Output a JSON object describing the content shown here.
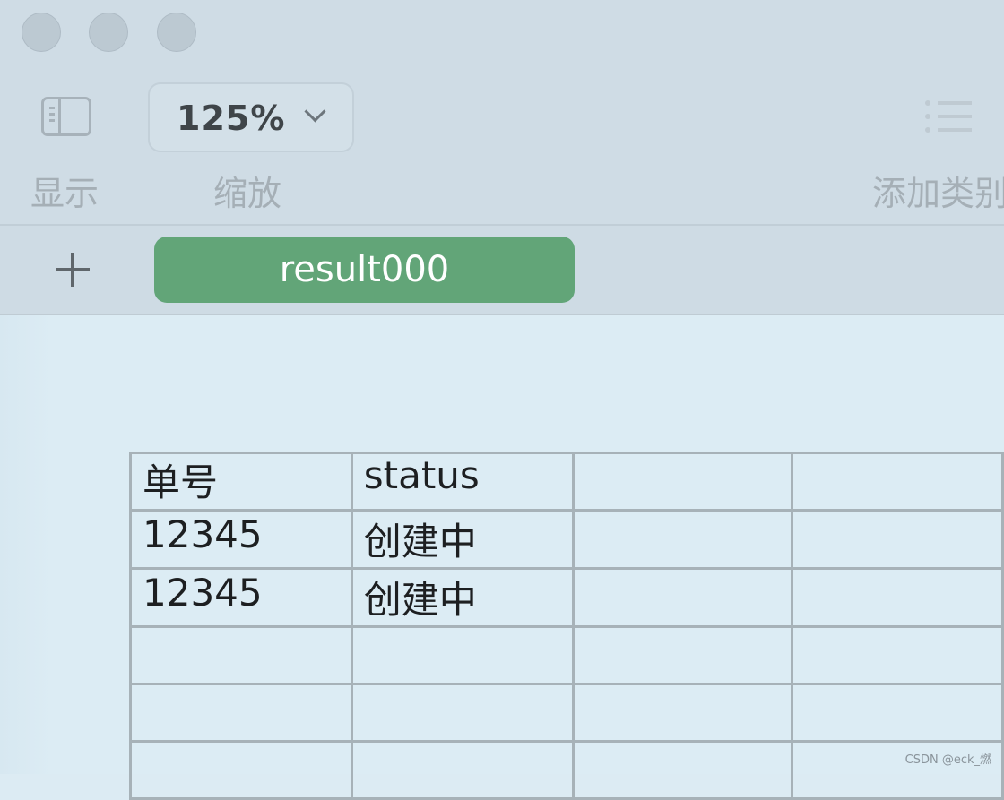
{
  "window": {
    "controls": [
      "close",
      "minimize",
      "zoom"
    ]
  },
  "toolbar": {
    "display_label": "显示",
    "zoom_label": "缩放",
    "zoom_value": "125%",
    "add_category_label": "添加类别",
    "icons": [
      "sidebar-icon",
      "chevron-down-icon",
      "list-icon"
    ]
  },
  "tabs": {
    "add_sheet_icon": "plus-icon",
    "items": [
      {
        "label": "result000",
        "active": true,
        "color": "#62a578"
      }
    ]
  },
  "sheet": {
    "rows": [
      [
        "单号",
        "status",
        "",
        ""
      ],
      [
        "12345",
        "创建中",
        "",
        ""
      ],
      [
        "12345",
        "创建中",
        "",
        ""
      ],
      [
        "",
        "",
        "",
        ""
      ],
      [
        "",
        "",
        "",
        ""
      ],
      [
        "",
        "",
        "",
        ""
      ]
    ]
  },
  "watermark": "CSDN @eck_燃"
}
